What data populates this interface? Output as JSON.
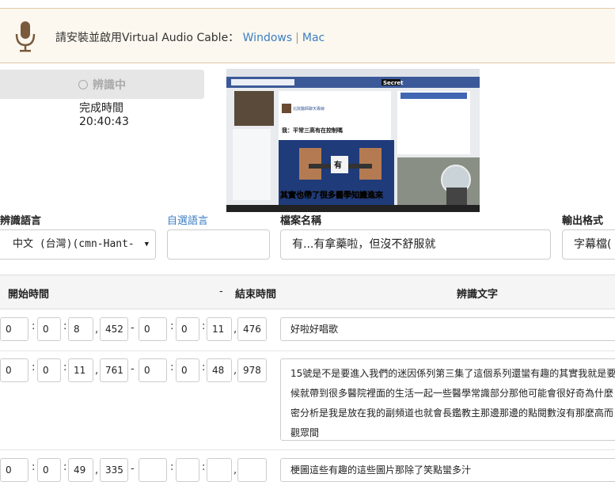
{
  "banner": {
    "text": "請安裝並啟用Virtual Audio Cable：",
    "link_windows": "Windows",
    "separator": "|",
    "link_mac": "Mac",
    "icon": "microphone-icon"
  },
  "status": {
    "button_label": "辨識中",
    "done_label": "完成時間",
    "done_time": "20:40:43"
  },
  "video": {
    "secret_label": "Secret",
    "post_title": "我：平常三高有在控制嗎",
    "sign_text": "有",
    "subtitle": "其實也帶了很多醫學知識進來",
    "page_name": "北院醫師聊天專線"
  },
  "form": {
    "language_label": "辨識語言",
    "language_value": "中文 (台灣)(cmn-Hant-",
    "custom_language_label": "自選語言",
    "custom_language_value": "",
    "filename_label": "檔案名稱",
    "filename_value": "有...有拿藥啦，但沒不舒服就",
    "format_label": "輸出格式",
    "format_value": "字幕檔("
  },
  "table": {
    "col_start": "開始時間",
    "col_dash": "-",
    "col_end": "結束時間",
    "col_text": "辨識文字",
    "rows": [
      {
        "start": [
          "0",
          "0",
          "8",
          "452"
        ],
        "end": [
          "0",
          "0",
          "11",
          "476"
        ],
        "text": "好啦好唱歌"
      },
      {
        "start": [
          "0",
          "0",
          "11",
          "761"
        ],
        "end": [
          "0",
          "0",
          "48",
          "978"
        ],
        "text": "15號是不是要進入我們的迷因係列第三集了這個系列還蠻有趣的其實我就是要\n候就帶到很多醫院裡面的生活一起一些醫學常識部分那他可能會很好奇為什麼\n密分析是我是放在我的副頻道也就會長鑑教主那邊那邊的點閱數沒有那麼高而\n觀眾間"
      },
      {
        "start": [
          "0",
          "0",
          "49",
          "335"
        ],
        "end": [
          "",
          "",
          "",
          ""
        ],
        "text": "梗圖這些有趣的這些圖片那除了笑點蠻多汁"
      }
    ]
  }
}
